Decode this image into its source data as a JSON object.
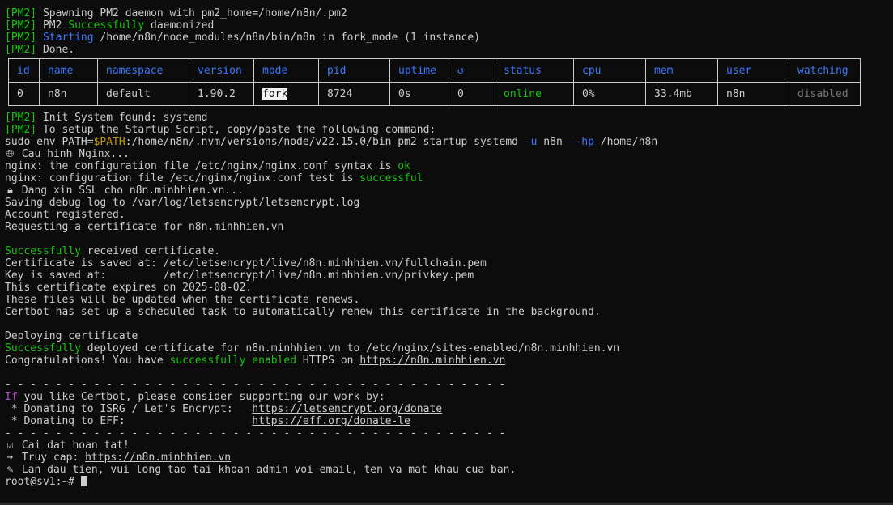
{
  "colors": {
    "background": "#0c0c0c",
    "text": "#cccccc",
    "green": "#16c60c",
    "blue": "#3b78ff",
    "magenta": "#b148c6"
  },
  "pm2_tag": "[PM2]",
  "lines": {
    "l1": "Spawning PM2 daemon with pm2_home=/home/n8n/.pm2",
    "l2a": "PM2 ",
    "l2b": "Successfully",
    "l2c": " daemonized",
    "l3a": "Starting",
    "l3b": " /home/n8n/node_modules/n8n/bin/n8n in fork_mode (1 instance)",
    "l4": "Done."
  },
  "table": {
    "headers": [
      "id",
      "name",
      "namespace",
      "version",
      "mode",
      "pid",
      "uptime",
      "↺",
      "status",
      "cpu",
      "mem",
      "user",
      "watching"
    ],
    "row": [
      "0",
      "n8n",
      "default",
      "1.90.2",
      "fork",
      "8724",
      "0s",
      "0",
      "online",
      "0%",
      "33.4mb",
      "n8n",
      "disabled"
    ]
  },
  "after": {
    "init": "Init System found: systemd",
    "setup": "To setup the Startup Script, copy/paste the following command:",
    "sudo_a": "sudo env PATH=",
    "sudo_var": "$PATH",
    "sudo_b": ":/home/n8n/.nvm/versions/node/v22.15.0/bin pm2 startup systemd ",
    "sudo_u": "-u",
    "sudo_c": " n8n ",
    "sudo_hp": "--hp",
    "sudo_d": " /home/n8n",
    "nginx_cfg": "Cau hinh Nginx...",
    "nginx1a": "nginx: the configuration file /etc/nginx/nginx.conf syntax is ",
    "nginx1b": "ok",
    "nginx2a": "nginx: configuration file /etc/nginx/nginx.conf test is ",
    "nginx2b": "successful",
    "ssl": "Dang xin SSL cho n8n.minhhien.vn...",
    "debug": "Saving debug log to /var/log/letsencrypt/letsencrypt.log",
    "account": "Account registered.",
    "request": "Requesting a certificate for n8n.minhhien.vn",
    "recv_a": "Successfully",
    "recv_b": " received certificate.",
    "cert_saved": "Certificate is saved at: /etc/letsencrypt/live/n8n.minhhien.vn/fullchain.pem",
    "key_saved": "Key is saved at:         /etc/letsencrypt/live/n8n.minhhien.vn/privkey.pem",
    "expires": "This certificate expires on 2025-08-02.",
    "renew_note": "These files will be updated when the certificate renews.",
    "task": "Certbot has set up a scheduled task to automatically renew this certificate in the background.",
    "deploying": "Deploying certificate",
    "deploy_a": "Successfully",
    "deploy_b": " deployed certificate for n8n.minhhien.vn to /etc/nginx/sites-enabled/n8n.minhhien.vn",
    "congrats_a": "Congratulations! You have ",
    "congrats_b": "successfully enabled",
    "congrats_c": " HTTPS on ",
    "congrats_link": "https://n8n.minhhien.vn",
    "dashes": "- - - - - - - - - - - - - - - - - - - - - - - - - - - - - - - - - - - - - - - -",
    "if_a": "If",
    "if_b": " you like Certbot, please consider supporting our work by:",
    "don1": " * Donating to ISRG / Let's Encrypt:   ",
    "don1_link": "https://letsencrypt.org/donate",
    "don2": " * Donating to EFF:                    ",
    "don2_link": "https://eff.org/donate-le",
    "done": "Cai dat hoan tat!",
    "access": "Truy cap: ",
    "access_link": "https://n8n.minhhien.vn",
    "first": "Lan dau tien, vui long tao tai khoan admin voi email, ten va mat khau cua ban.",
    "prompt": "root@sv1:~# "
  },
  "icons": {
    "globe": "globe-icon",
    "lock": "lock-icon",
    "check": "checkbox-icon",
    "arrow": "arrow-right-icon",
    "note": "note-icon"
  }
}
